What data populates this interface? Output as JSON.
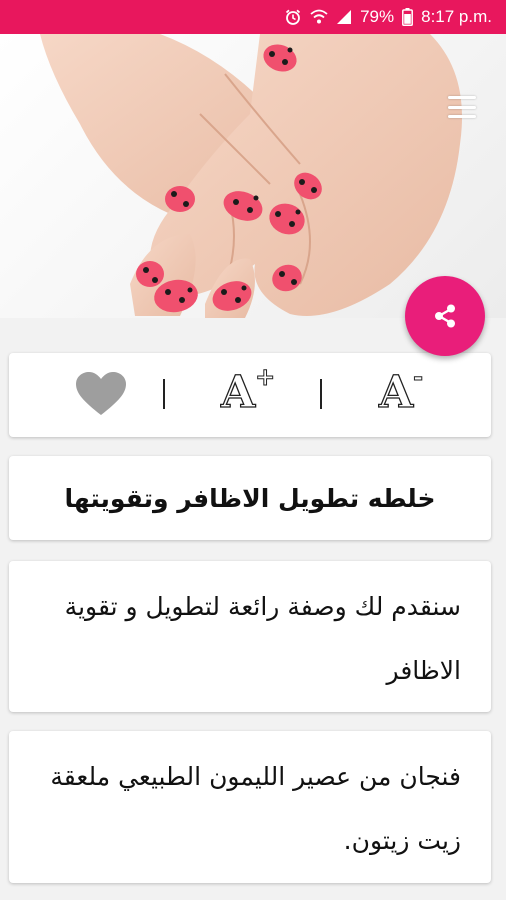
{
  "status_bar": {
    "battery": "79%",
    "time": "8:17 p.m.",
    "icons": [
      "alarm-icon",
      "wifi-icon",
      "signal-icon",
      "battery-icon"
    ]
  },
  "colors": {
    "accent": "#e8175d",
    "fab": "#e91e7a",
    "heart": "#9e9e9e"
  },
  "toolbar": {
    "favorite_icon": "heart-icon",
    "increase_font_label": "A",
    "increase_font_mark": "+",
    "decrease_font_label": "A",
    "decrease_font_mark": "-"
  },
  "article": {
    "title": "خلطه تطويل الاظافر وتقويتها",
    "paragraphs": [
      "سنقدم لك وصفة رائعة لتطويل و تقوية الاظافر",
      "فنجان من عصير الليمون الطبيعي ملعقة زيت زيتون."
    ]
  }
}
